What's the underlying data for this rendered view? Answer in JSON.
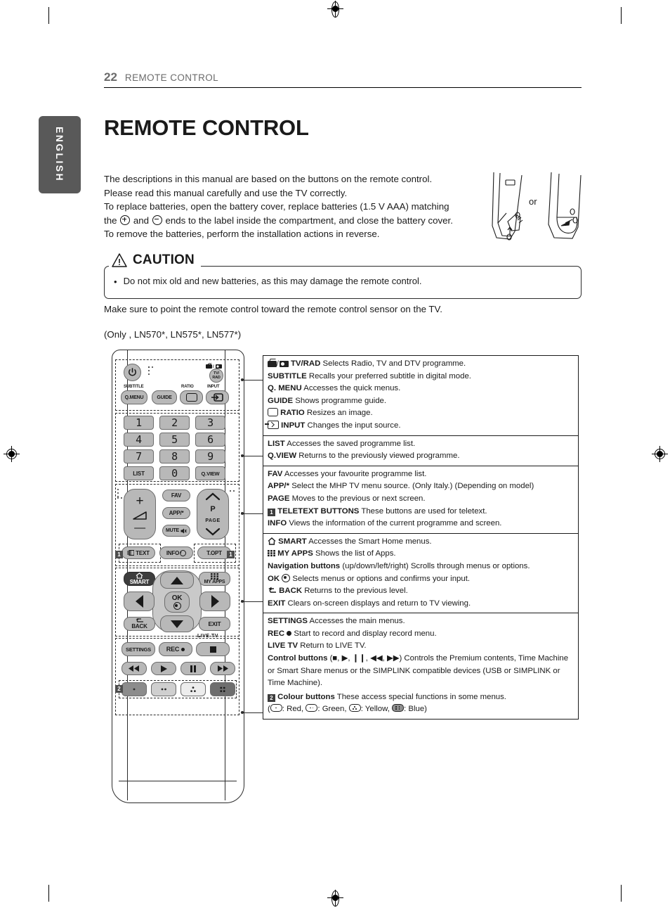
{
  "header": {
    "page_number": "22",
    "section": "REMOTE CONTROL"
  },
  "language_tab": "ENGLISH",
  "title": "REMOTE CONTROL",
  "intro": {
    "line1": "The descriptions in this manual are based on the buttons on the remote control.",
    "line2": "Please read this manual carefully and use the TV correctly.",
    "line3_a": "To replace batteries, open the battery cover, replace batteries (1.5 V AAA) matching",
    "line4_a": "the ",
    "line4_b": " and ",
    "line4_c": " ends to the label inside the compartment, and close the battery cover.",
    "line5": "To remove the batteries, perform the installation actions in reverse."
  },
  "battery_illustration": {
    "or_label": "or"
  },
  "caution": {
    "title": "CAUTION",
    "bullet": "•",
    "text": "Do not mix old and new batteries, as this may damage the remote control."
  },
  "notes": {
    "point_note": "Make sure to point the remote control toward the remote control sensor on the TV.",
    "models": "(Only , LN570*, LN575*, LN577*)"
  },
  "remote": {
    "buttons": {
      "power": "⏻",
      "tv_rad": "TV/\nRAD",
      "tv_rad_line1": "TV/",
      "tv_rad_line2": "RAD",
      "subtitle_label": "SUBTITLE",
      "q_menu": "Q.MENU",
      "guide": "GUIDE",
      "ratio_label": "RATIO",
      "input_label": "INPUT",
      "num1": "1",
      "num2": "2",
      "num3": "3",
      "num4": "4",
      "num5": "5",
      "num6": "6",
      "num7": "7",
      "num8": "8",
      "num9": "9",
      "list": "LIST",
      "num0": "0",
      "qview": "Q.VIEW",
      "vol_plus": "+",
      "vol_minus": "—",
      "fav": "FAV",
      "app": "APP/*",
      "mute": "MUTE",
      "p": "P",
      "page": "PAGE",
      "text": "TEXT",
      "info": "INFO",
      "topt": "T.OPT",
      "smart": "SMART",
      "my_apps": "MY APPS",
      "ok": "OK",
      "back": "BACK",
      "exit": "EXIT",
      "live_tv": "LIVE TV",
      "settings": "SETTINGS",
      "rec": "REC",
      "stop": "■",
      "rew": "◀◀",
      "play": "▶",
      "pause": "❙❙",
      "ff": "▶▶",
      "badge_1": "1",
      "badge_2": "2"
    }
  },
  "descriptions": [
    {
      "lines": [
        {
          "icon": "tv-rad-icon",
          "bold": "TV/RAD",
          "rest": " Selects Radio, TV and DTV programme."
        },
        {
          "icon": "",
          "bold": "SUBTITLE",
          "rest": " Recalls your preferred subtitle in digital mode."
        },
        {
          "icon": "",
          "bold": "Q. MENU",
          "rest": " Accesses the quick menus."
        },
        {
          "icon": "",
          "bold": "GUIDE",
          "rest": " Shows programme guide."
        },
        {
          "icon": "ratio-icon",
          "bold": "RATIO",
          "rest": " Resizes an image."
        },
        {
          "icon": "input-icon",
          "bold": "INPUT",
          "rest": " Changes the input source."
        }
      ]
    },
    {
      "lines": [
        {
          "icon": "",
          "bold": "LIST",
          "rest": " Accesses the saved  programme list."
        },
        {
          "icon": "",
          "bold": "Q.VIEW",
          "rest": " Returns to the previously viewed programme."
        }
      ]
    },
    {
      "lines": [
        {
          "icon": "",
          "bold": "FAV",
          "rest": " Accesses your favourite programme list."
        },
        {
          "icon": "",
          "bold": "APP/*",
          "rest": " Select the MHP TV menu source. (Only Italy.) (Depending on model)"
        },
        {
          "icon": "",
          "bold": "PAGE",
          "rest": " Moves to the previous or next screen."
        },
        {
          "icon": "badge-1-icon",
          "bold": "TELETEXT BUTTONS",
          "rest": " These buttons are used for teletext."
        },
        {
          "icon": "",
          "bold": "INFO",
          "rest": " Views the information of the current programme and screen."
        }
      ]
    },
    {
      "lines": [
        {
          "icon": "home-icon",
          "bold": "SMART",
          "rest": " Accesses the Smart Home menus."
        },
        {
          "icon": "apps-grid-icon",
          "bold": "MY APPS",
          "rest": " Shows the list of Apps."
        },
        {
          "icon": "",
          "bold": "Navigation buttons",
          "rest": " (up/down/left/right) Scrolls through menus or options."
        },
        {
          "icon": "",
          "bold": "OK",
          "rest": " Selects menus or options and confirms your input.",
          "mid_icon": "ok-icon"
        },
        {
          "icon": "back-arrow-icon",
          "bold": "BACK",
          "rest": " Returns to the previous level."
        },
        {
          "icon": "",
          "bold": "EXIT",
          "rest": " Clears on-screen displays and return to TV viewing."
        }
      ]
    },
    {
      "lines": [
        {
          "icon": "",
          "bold": "SETTINGS",
          "rest": " Accesses the main menus."
        },
        {
          "icon": "",
          "bold": "REC",
          "rest": " Start to record and display record menu.",
          "mid_icon": "rec-dot-icon"
        },
        {
          "icon": "",
          "bold": "LIVE TV",
          "rest": " Return to LIVE TV."
        },
        {
          "icon": "",
          "bold": "Control buttons",
          "rest": " (■, ▶, ❙❙, ◀◀, ▶▶) Controls the Premium contents, Time Machine or Smart Share menus or the SIMPLINK compatible devices (USB or SIMPLINK or Time Machine)."
        },
        {
          "icon": "badge-2-icon",
          "bold": "Colour buttons",
          "rest": " These access special functions in some menus."
        },
        {
          "icon": "",
          "bold": "",
          "rest": "Red,  Green,  Yellow,  Blue",
          "colour_legend": true,
          "open_paren": "(",
          "red": ": Red, ",
          "green": ": Green, ",
          "yellow": ": Yellow, ",
          "blue": ": Blue)"
        }
      ]
    }
  ]
}
